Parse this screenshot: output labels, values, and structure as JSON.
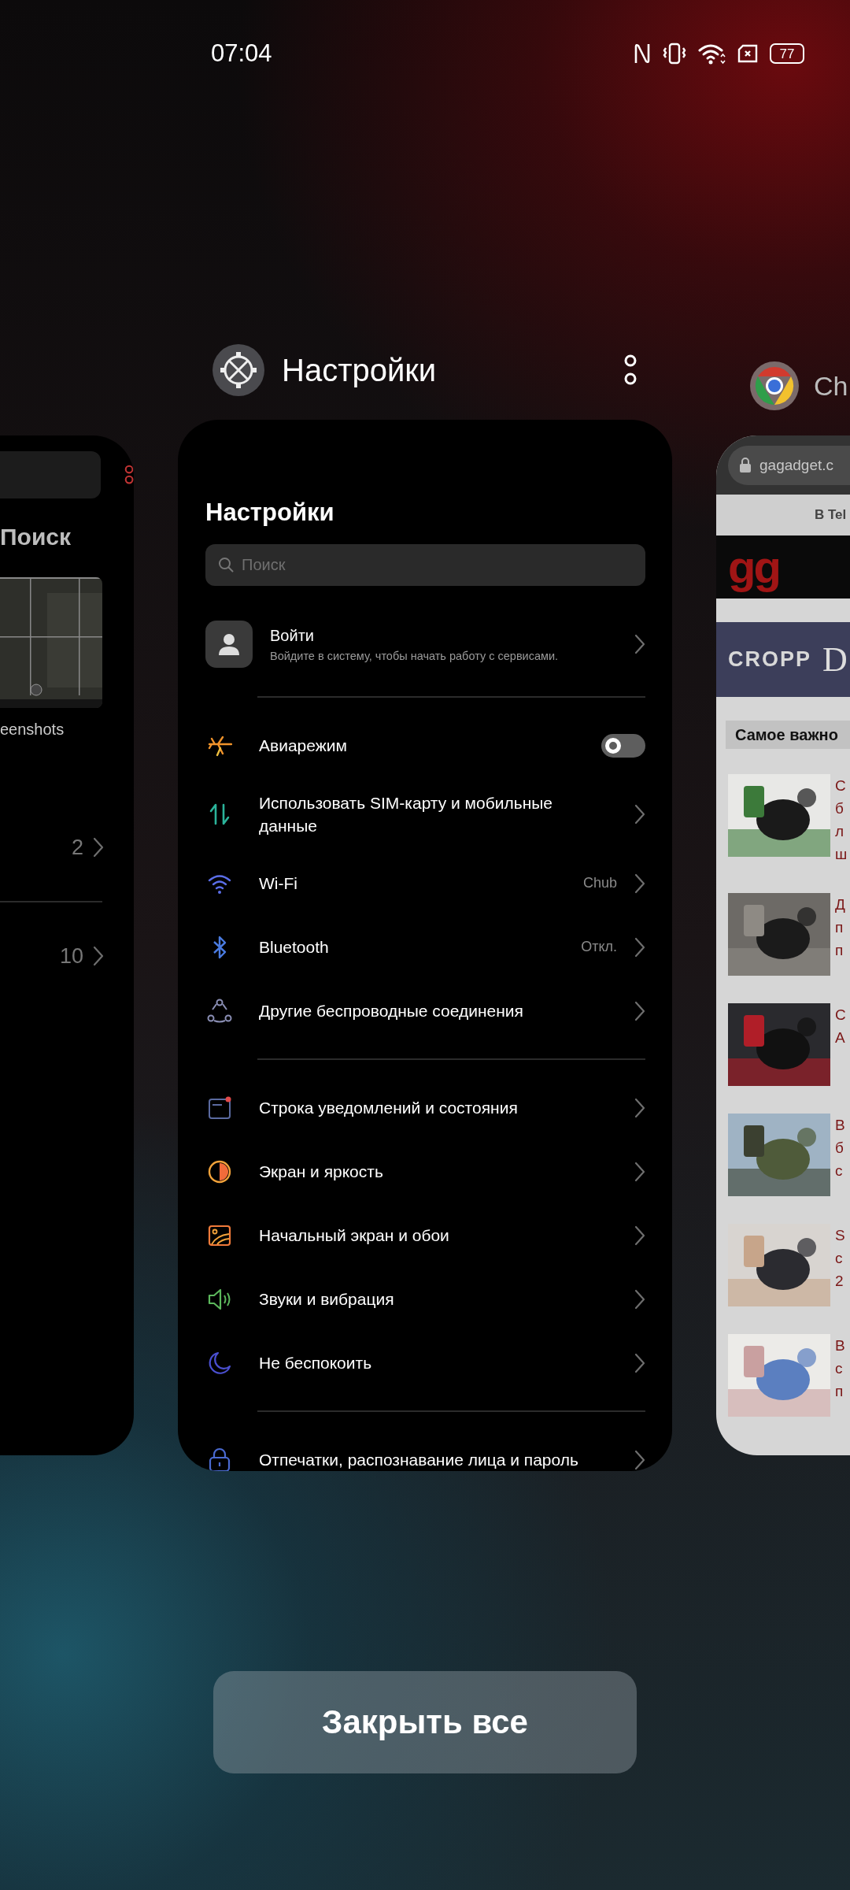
{
  "status_bar": {
    "time": "07:04",
    "battery": "77"
  },
  "recent_apps": [
    {
      "kind": "gallery",
      "search_title": "Поиск",
      "album": "eenshots",
      "rows": [
        {
          "count": "2"
        },
        {
          "count": "10"
        }
      ]
    },
    {
      "kind": "settings",
      "app_name": "Настройки",
      "screen": {
        "title": "Настройки",
        "search": {
          "placeholder": "Поиск"
        },
        "account": {
          "title": "Войти",
          "subtitle": "Войдите в систему, чтобы начать работу с сервисами."
        },
        "groups": [
          {
            "items": [
              {
                "kind": "toggle",
                "label": "Авиарежим",
                "on": false
              },
              {
                "kind": "link",
                "label": "Использовать SIM-карту и мобильные данные"
              },
              {
                "kind": "link",
                "label": "Wi-Fi",
                "value": "Chub"
              },
              {
                "kind": "link",
                "label": "Bluetooth",
                "value": "Откл."
              },
              {
                "kind": "link",
                "label": "Другие беспроводные соединения"
              }
            ]
          },
          {
            "items": [
              {
                "kind": "link",
                "label": "Строка уведомлений и состояния"
              },
              {
                "kind": "link",
                "label": "Экран и яркость"
              },
              {
                "kind": "link",
                "label": "Начальный экран и обои"
              },
              {
                "kind": "link",
                "label": "Звуки и вибрация"
              },
              {
                "kind": "link",
                "label": "Не беспокоить"
              }
            ]
          },
          {
            "items": [
              {
                "kind": "link",
                "label": "Отпечатки, распознавание лица и пароль"
              }
            ]
          }
        ]
      }
    },
    {
      "kind": "browser",
      "app_name": "Ch",
      "url": "gagadget.c",
      "banner": "В Tel",
      "logo": "gg",
      "ad": [
        "CROPP",
        "D"
      ],
      "section": "Самое важно",
      "articles": [
        {
          "lines": [
            "С",
            "б",
            "л",
            "ш"
          ]
        },
        {
          "lines": [
            "Д",
            "п",
            "п"
          ]
        },
        {
          "lines": [
            "С",
            "А"
          ]
        },
        {
          "lines": [
            "В",
            "б",
            "с"
          ]
        },
        {
          "lines": [
            "S",
            "с",
            "2"
          ]
        },
        {
          "lines": [
            "В",
            "с",
            "п"
          ]
        }
      ]
    }
  ],
  "close_all": "Закрыть все"
}
